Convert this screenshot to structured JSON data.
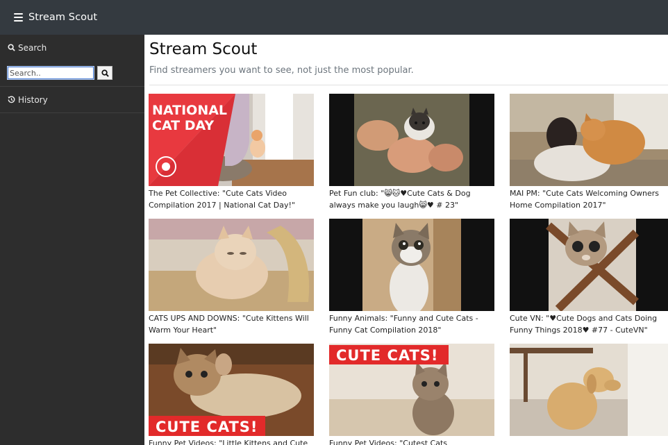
{
  "app": {
    "title": "Stream Scout"
  },
  "sidebar": {
    "search_label": "Search",
    "search_placeholder": "Search..",
    "history_label": "History"
  },
  "main": {
    "title": "Stream Scout",
    "subtitle": "Find streamers you want to see, not just the most popular."
  },
  "thumb_text": {
    "national_1": "NATIONAL",
    "national_2": "CAT DAY",
    "cute_cats": "CUTE CATS!",
    "cute_cats_2": "CUTE CATS!"
  },
  "videos": [
    {
      "caption": "The Pet Collective: \"Cute Cats Video Compilation 2017 | National Cat Day!\""
    },
    {
      "caption": "Pet Fun club: \"😸🐱♥Cute Cats & Dog always make you laugh😸♥ # 23\""
    },
    {
      "caption": "MAI PM: \"Cute Cats Welcoming Owners Home Compilation 2017\""
    },
    {
      "caption": "CATS UPS AND DOWNS: \"Cute Kittens Will Warm Your Heart\""
    },
    {
      "caption": "Funny Animals: \"Funny and Cute Cats - Funny Cat Compilation 2018\""
    },
    {
      "caption": "Cute VN: \"♥Cute Dogs and Cats Doing Funny Things 2018♥ #77 - CuteVN\""
    },
    {
      "caption": "Funny Pet Videos: \"Little Kittens and Cute Cats"
    },
    {
      "caption": "Funny Pet Videos: \"Cutest Cats Compilation"
    },
    {
      "caption": ""
    }
  ]
}
